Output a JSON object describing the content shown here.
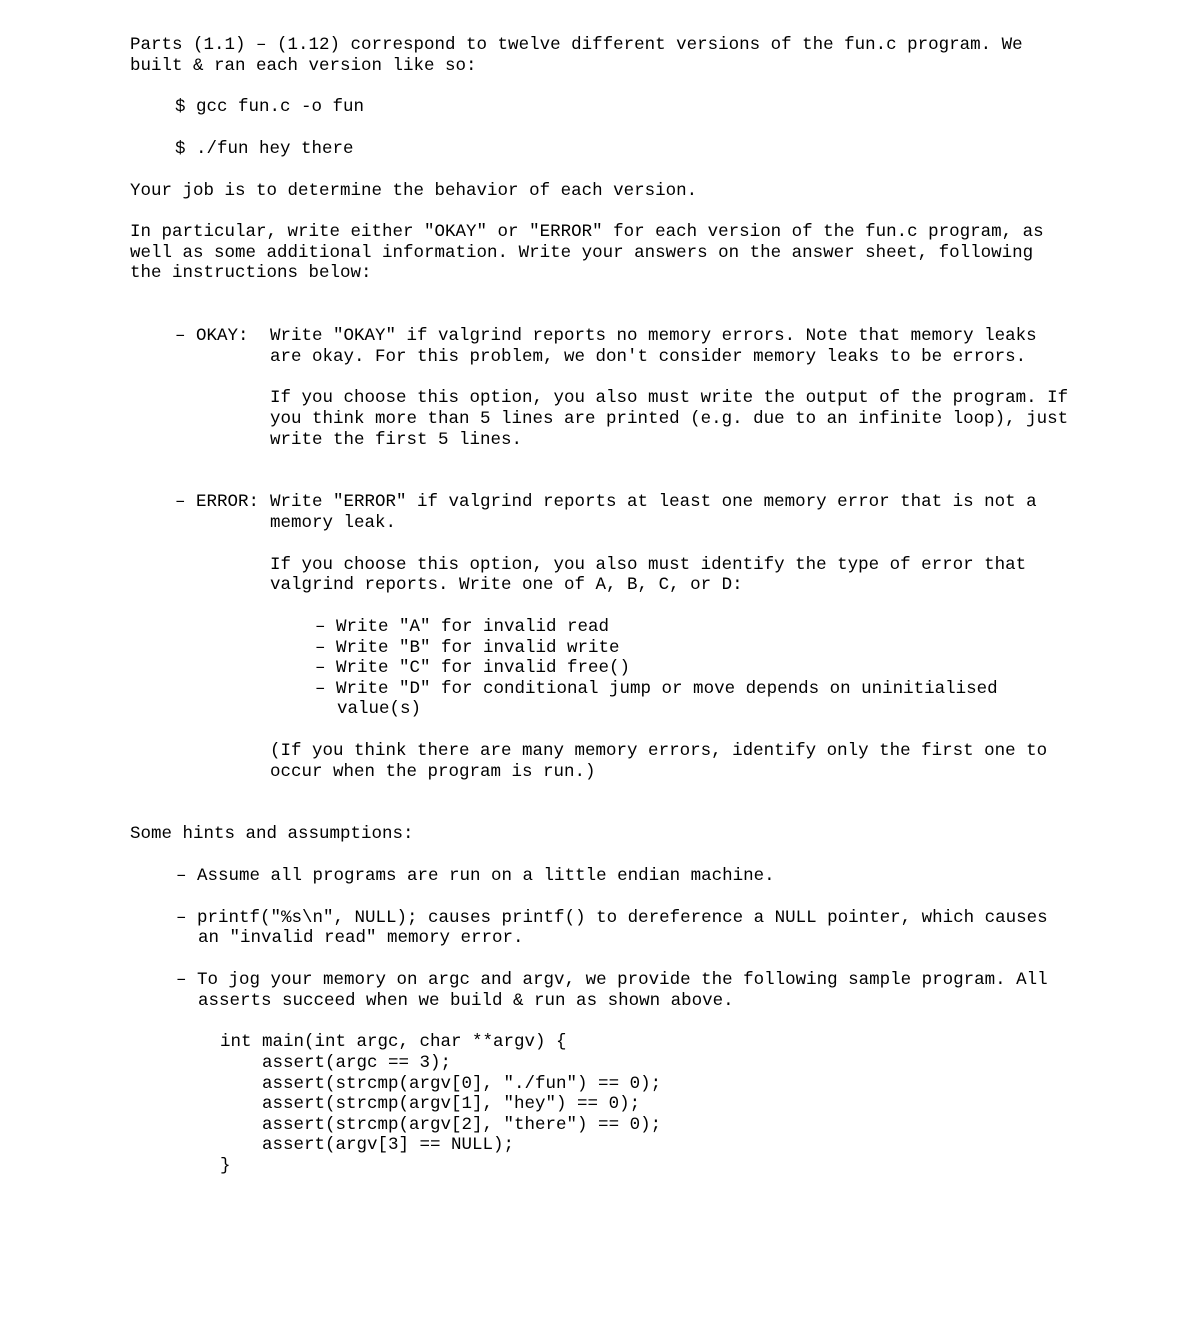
{
  "intro": {
    "p1": "Parts (1.1) – (1.12) correspond to twelve different versions of the fun.c program. We built & ran each version like so:",
    "cmd1": "$ gcc fun.c -o fun",
    "cmd2": "$ ./fun hey there",
    "p2": "Your job is to determine the behavior of each version.",
    "p3": "In particular, write either \"OKAY\" or \"ERROR\" for each version of the fun.c program, as well as some additional information. Write your answers on the answer sheet, following the instructions below:"
  },
  "okay": {
    "label": "– OKAY:",
    "p1": "Write \"OKAY\" if valgrind reports no memory errors. Note that memory leaks are okay. For this problem, we don't consider memory leaks to be errors.",
    "p2": "If you choose this option, you also must write the output of the program. If you think more than 5 lines are printed (e.g. due to an infinite loop), just write the first 5 lines."
  },
  "error": {
    "label": "– ERROR:",
    "p1": "Write \"ERROR\" if valgrind reports at least one memory error that is not a memory leak.",
    "p2": "If you choose this option, you also must identify the type of error that valgrind reports. Write one of A, B, C, or D:",
    "items": {
      "a": "– Write \"A\" for invalid read",
      "b": "– Write \"B\" for invalid write",
      "c": "– Write \"C\" for invalid free()",
      "d": "– Write \"D\" for conditional jump or move depends on uninitialised value(s)"
    },
    "paren": "(If you think there are many memory errors, identify only the first one to occur when the program is run.)"
  },
  "hints": {
    "heading": "Some hints and assumptions:",
    "h1": "– Assume all programs are run on a little endian machine.",
    "h2": "– printf(\"%s\\n\", NULL);  causes printf() to dereference a NULL pointer, which causes an \"invalid read\" memory error.",
    "h3": "– To jog your memory on argc and argv, we provide the following sample program. All asserts succeed when we build & run as shown above."
  },
  "code": {
    "l1": "int main(int argc, char **argv) {",
    "l2": "    assert(argc == 3);",
    "l3": "    assert(strcmp(argv[0], \"./fun\") == 0);",
    "l4": "    assert(strcmp(argv[1], \"hey\") == 0);",
    "l5": "    assert(strcmp(argv[2], \"there\") == 0);",
    "l6": "    assert(argv[3] == NULL);",
    "l7": "}"
  }
}
